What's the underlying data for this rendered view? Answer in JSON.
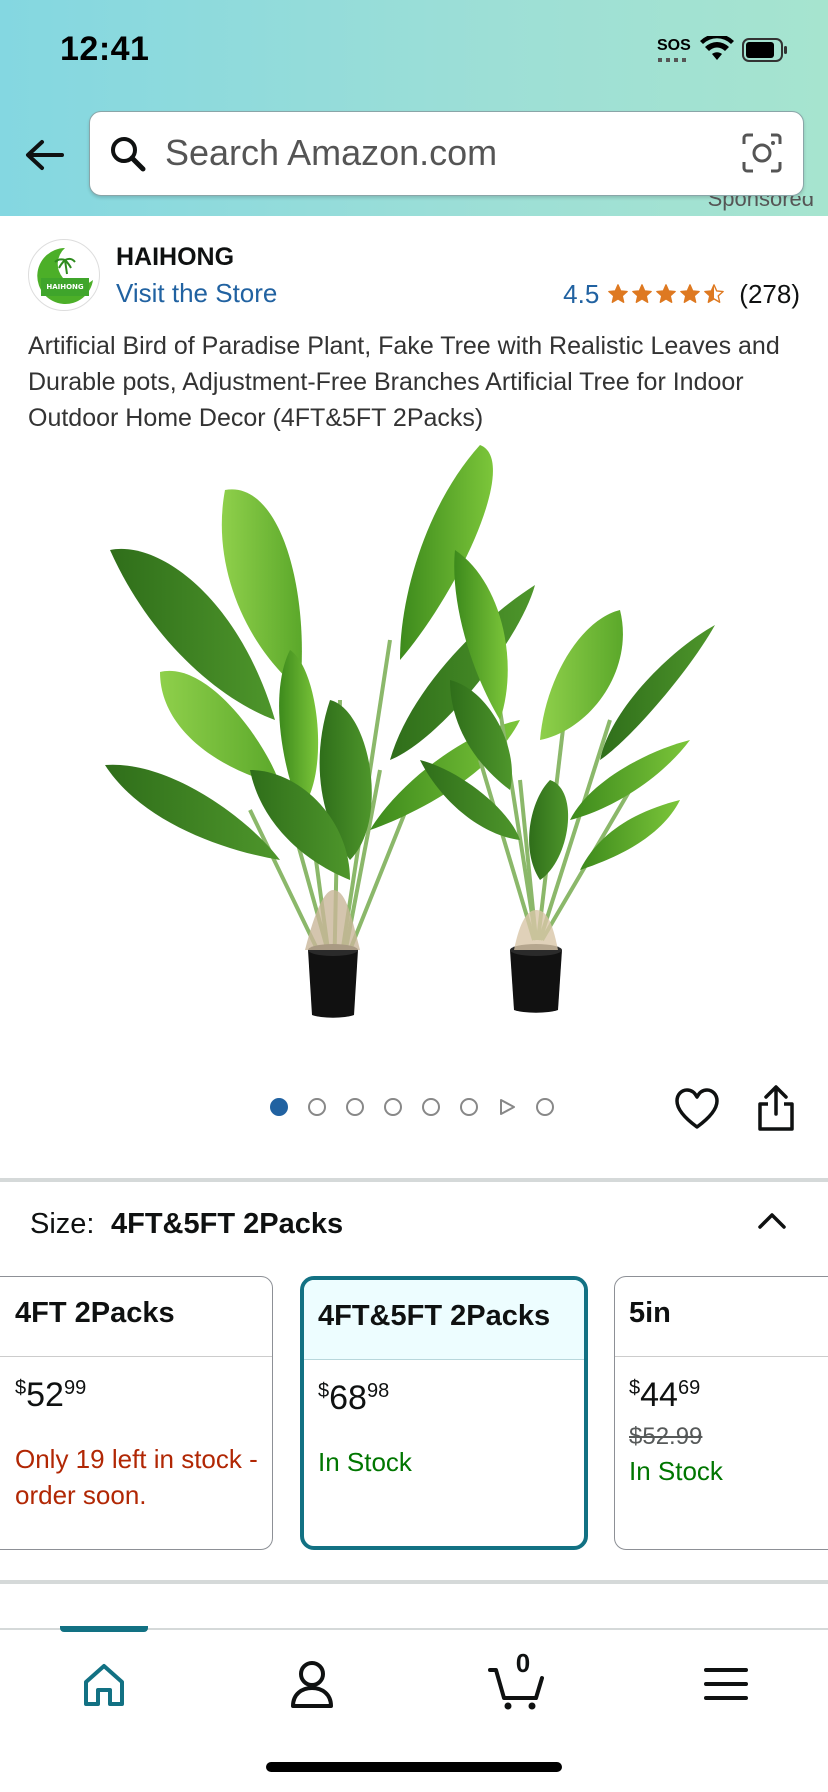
{
  "status_bar": {
    "time": "12:41",
    "carrier": "SOS"
  },
  "search": {
    "placeholder": "Search Amazon.com"
  },
  "sponsored_label": "Sponsored",
  "brand": {
    "name": "HAIHONG",
    "visit_label": "Visit the Store",
    "logo_text": "HAIHONG"
  },
  "rating": {
    "value": "4.5",
    "stars": 4.5,
    "count": "(278)"
  },
  "product": {
    "title": "Artificial Bird of Paradise Plant, Fake Tree with Realistic Leaves and Durable pots, Adjustment-Free Branches Artificial Tree for Indoor Outdoor Home Decor (4FT&5FT 2Packs)"
  },
  "carousel": {
    "total_dots": 8,
    "active_index": 0,
    "video_index": 6
  },
  "size": {
    "label": "Size:",
    "selected": "4FT&5FT 2Packs",
    "options": [
      {
        "name": "4FT 2Packs",
        "currency": "$",
        "whole": "52",
        "cents": "99",
        "strike": "",
        "stock": "Only 19 left in stock - order soon."
      },
      {
        "name": "4FT&5FT 2Packs",
        "currency": "$",
        "whole": "68",
        "cents": "98",
        "strike": "",
        "stock": "In Stock"
      },
      {
        "name": "5in",
        "currency": "$",
        "whole": "44",
        "cents": "69",
        "strike": "$52.99",
        "stock": "In Stock"
      }
    ]
  },
  "nav": {
    "cart_count": "0"
  },
  "colors": {
    "accent": "#127183",
    "link": "#2162a1",
    "star": "#de7921",
    "in_stock": "#007600",
    "low_stock": "#b12704"
  }
}
